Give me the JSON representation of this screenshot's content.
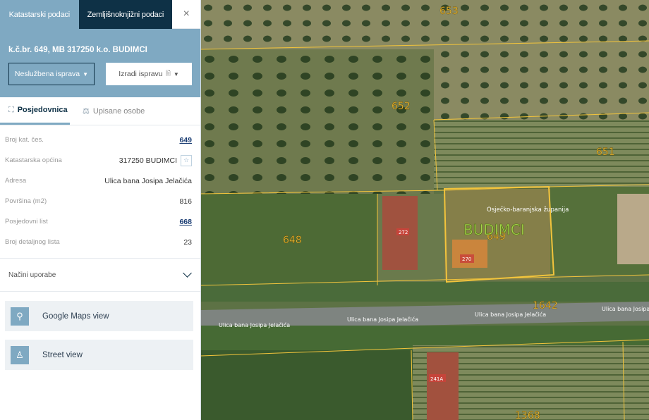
{
  "tabs": {
    "katastarski": "Katastarski podaci",
    "zemljisnoknjizni": "Zemljišnoknjižni podaci",
    "close": "×"
  },
  "parcel_title": "k.č.br. 649, MB 317250 k.o. BUDIMCI",
  "buttons": {
    "nesluzbena": "Neslužbena isprava",
    "izradi": "Izradi ispravu"
  },
  "subtabs": {
    "posjednica": "Posjedovnica",
    "upisane": "Upisane osobe"
  },
  "props": [
    {
      "label": "Broj kat. čes.",
      "value": "649"
    },
    {
      "label": "Katastarska općina",
      "value": "317250 BUDIMCI"
    },
    {
      "label": "Adresa",
      "value": "Ulica bana Josipa Jelačića"
    },
    {
      "label": "Površina (m2)",
      "value": "816"
    },
    {
      "label": "Posjedovni list",
      "value": "668"
    },
    {
      "label": "Broj detaljnog lista",
      "value": "23"
    }
  ],
  "nacini": "Načini uporabe",
  "views": {
    "google": "Google Maps view",
    "street": "Street view"
  },
  "map": {
    "parcels": [
      "653",
      "652",
      "651",
      "648",
      "649",
      "1642",
      "1368"
    ],
    "place": "BUDIMCI",
    "county": "Osječko-baranjska županija",
    "street": "Ulica bana Josipa Jelačića",
    "buildings": [
      "272",
      "270",
      "241A"
    ],
    "accent": "#f2c43c"
  }
}
